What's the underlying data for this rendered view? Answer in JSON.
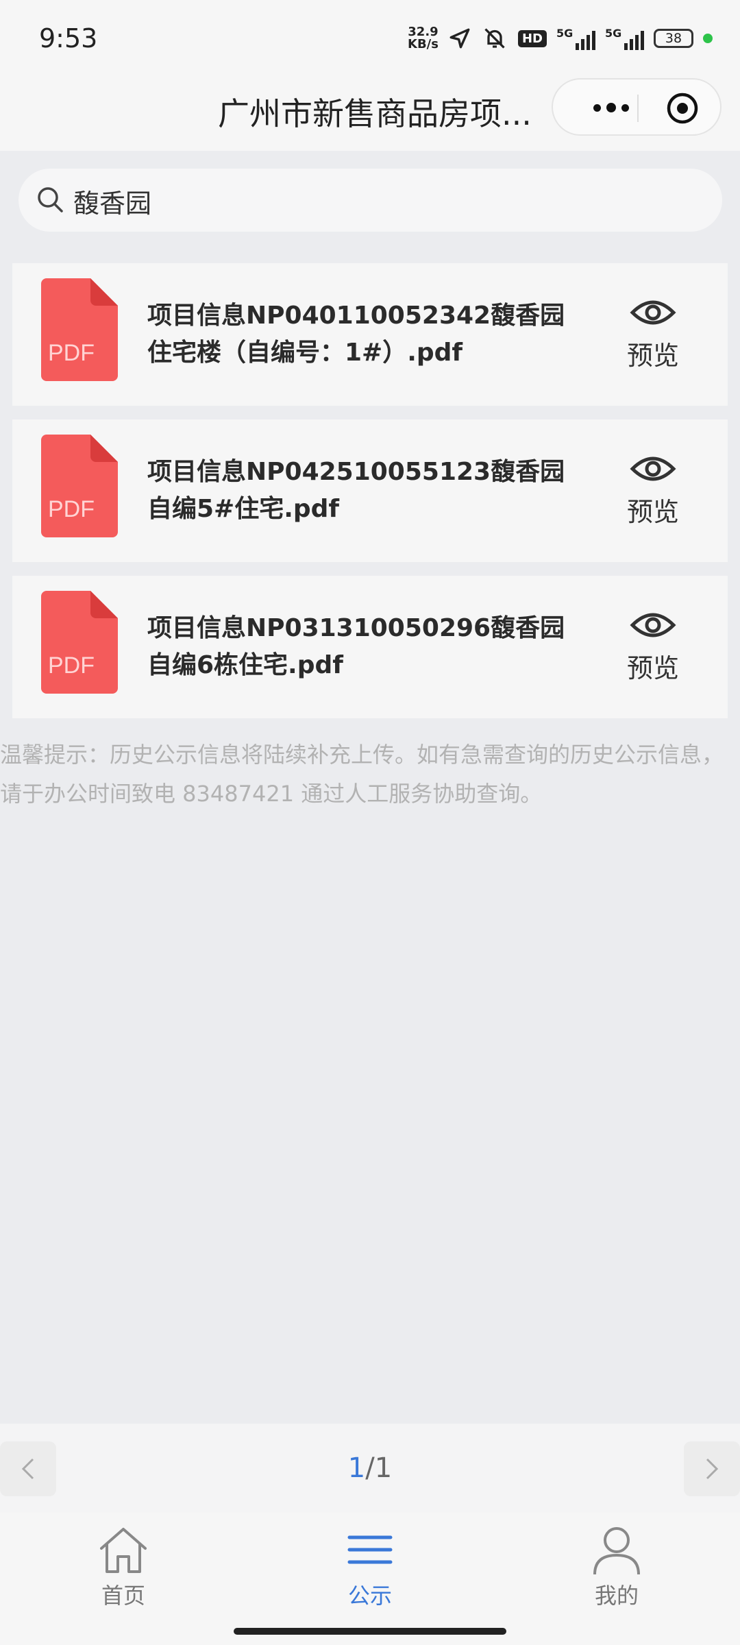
{
  "status_bar": {
    "time": "9:53",
    "net_speed_value": "32.9",
    "net_speed_unit": "KB/s",
    "hd_label": "HD",
    "sim1_label": "5G",
    "sim2_label": "5G",
    "battery": "38"
  },
  "nav": {
    "title": "广州市新售商品房项..."
  },
  "search": {
    "value": "馥香园",
    "placeholder": ""
  },
  "files": [
    {
      "title": "项目信息NP040110052342馥香园住宅楼（自编号：1#）.pdf",
      "action": "预览",
      "icon": "pdf-icon",
      "icon_label": "PDF"
    },
    {
      "title": "项目信息NP042510055123馥香园自编5#住宅.pdf",
      "action": "预览",
      "icon": "pdf-icon",
      "icon_label": "PDF"
    },
    {
      "title": "项目信息NP031310050296馥香园自编6栋住宅.pdf",
      "action": "预览",
      "icon": "pdf-icon",
      "icon_label": "PDF"
    }
  ],
  "tip": "温馨提示：历史公示信息将陆续补充上传。如有急需查询的历史公示信息，请于办公时间致电 83487421 通过人工服务协助查询。",
  "pager": {
    "current": "1",
    "separator": "/",
    "total": "1"
  },
  "tabs": [
    {
      "label": "首页",
      "icon": "home-icon",
      "active": false
    },
    {
      "label": "公示",
      "icon": "list-icon",
      "active": true
    },
    {
      "label": "我的",
      "icon": "user-icon",
      "active": false
    }
  ],
  "colors": {
    "accent": "#3a78d8",
    "pdf_red": "#f45b5b",
    "background": "#ebecef"
  }
}
